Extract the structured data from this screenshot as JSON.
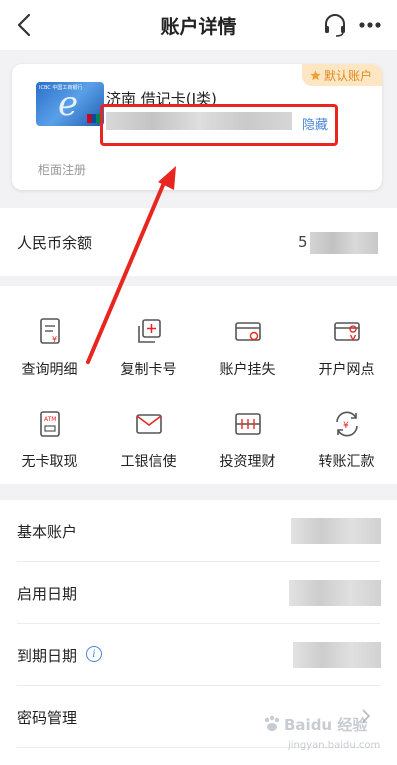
{
  "header": {
    "title": "账户详情",
    "back_icon": "chevron-left-icon",
    "support_icon": "headset-icon",
    "more_icon": "more-dots-icon"
  },
  "card": {
    "bank_caption": "ICBC 中国工商银行",
    "name": "济南 借记卡(I类)",
    "default_badge": "默认账户",
    "hide_label": "隐藏",
    "register_label": "柜面注册"
  },
  "balance": {
    "label": "人民币余额",
    "visible_digit": "5"
  },
  "functions": [
    {
      "label": "查询明细",
      "icon": "statement-icon"
    },
    {
      "label": "复制卡号",
      "icon": "copy-card-icon"
    },
    {
      "label": "账户挂失",
      "icon": "report-loss-icon"
    },
    {
      "label": "开户网点",
      "icon": "branch-location-icon"
    },
    {
      "label": "无卡取现",
      "icon": "atm-icon"
    },
    {
      "label": "工银信使",
      "icon": "envelope-icon"
    },
    {
      "label": "投资理财",
      "icon": "investment-icon"
    },
    {
      "label": "转账汇款",
      "icon": "transfer-icon"
    }
  ],
  "details": [
    {
      "label": "基本账户"
    },
    {
      "label": "启用日期"
    },
    {
      "label": "到期日期",
      "info_icon": "info-icon"
    },
    {
      "label": "密码管理",
      "chevron": "chevron-right-icon"
    }
  ],
  "watermark": {
    "brand": "Baidu 经验",
    "sub": "jingyan.baidu.com"
  },
  "colors": {
    "accent": "#e8261f",
    "link": "#4a86d8",
    "badge_bg": "#fde6c4",
    "badge_text": "#e08a1e",
    "page_bg": "#f2f2f4"
  }
}
